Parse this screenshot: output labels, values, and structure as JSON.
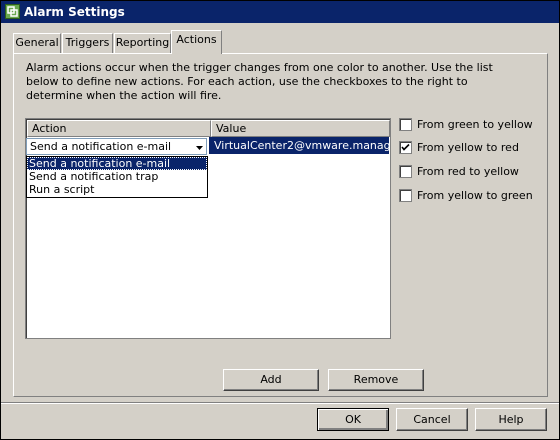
{
  "window": {
    "title": "Alarm Settings",
    "icon": "vmware-alarm-icon"
  },
  "tabs": [
    {
      "label": "General",
      "active": false
    },
    {
      "label": "Triggers",
      "active": false
    },
    {
      "label": "Reporting",
      "active": false
    },
    {
      "label": "Actions",
      "active": true
    }
  ],
  "description": "Alarm actions occur when the trigger changes from one color to another.  Use the list below to define new actions.  For each action,  use the checkboxes to the right to determine when the action will fire.",
  "table": {
    "columns": [
      "Action",
      "Value"
    ],
    "rows": [
      {
        "action": "Send a notification e-mail",
        "value": "VirtualCenter2@vmware.manag..."
      }
    ]
  },
  "action_dropdown": {
    "selected": "Send a notification e-mail",
    "options": [
      "Send a notification e-mail",
      "Send a notification trap",
      "Run a script"
    ]
  },
  "transitions": [
    {
      "label": "From green to yellow",
      "checked": false
    },
    {
      "label": "From yellow to red",
      "checked": true
    },
    {
      "label": "From red to yellow",
      "checked": false
    },
    {
      "label": "From yellow to green",
      "checked": false
    }
  ],
  "buttons": {
    "add": "Add",
    "remove": "Remove",
    "ok": "OK",
    "cancel": "Cancel",
    "help": "Help"
  },
  "colors": {
    "titlebar": "#0a246a",
    "selection": "#0a246a",
    "face": "#d4d0c8"
  }
}
